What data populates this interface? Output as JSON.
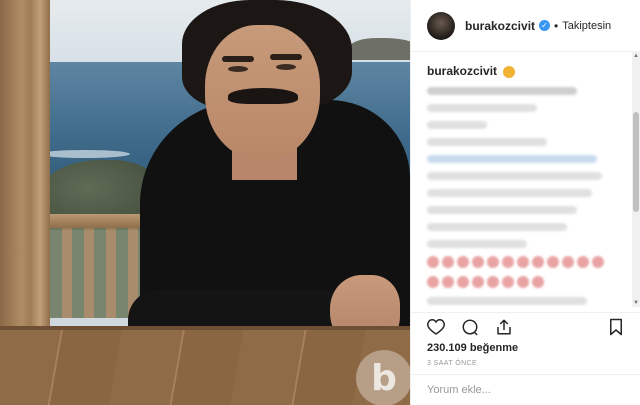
{
  "post": {
    "watermark_letter": "b"
  },
  "header": {
    "username": "burakozcivit",
    "verified_mark": "✓",
    "separator": "•",
    "follow_status": "Takiptesin"
  },
  "caption": {
    "username": "burakozcivit",
    "emoji_icon": "lion-face-icon"
  },
  "actions": {
    "like_icon": "heart-icon",
    "comment_icon": "comment-icon",
    "share_icon": "share-icon",
    "save_icon": "bookmark-icon"
  },
  "likes": {
    "text": "230.109 beğenme"
  },
  "timestamp": {
    "text": "3 SAAT ÖNCE"
  },
  "comment_input": {
    "placeholder": "Yorum ekle..."
  },
  "colors": {
    "verified": "#3897f0",
    "text": "#262626",
    "muted": "#999999",
    "border": "#efefef"
  }
}
